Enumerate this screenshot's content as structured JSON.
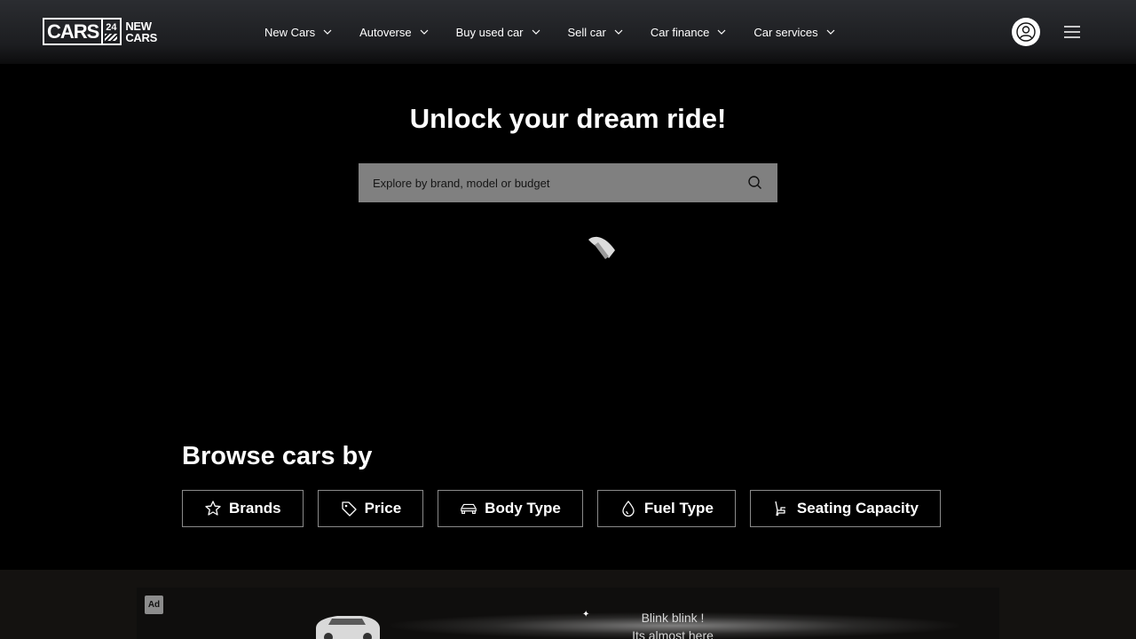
{
  "logo": {
    "primary": "CARS",
    "number": "24",
    "line1": "NEW",
    "line2": "CARS"
  },
  "nav": [
    {
      "label": "New Cars"
    },
    {
      "label": "Autoverse"
    },
    {
      "label": "Buy used car"
    },
    {
      "label": "Sell car"
    },
    {
      "label": "Car finance"
    },
    {
      "label": "Car services"
    }
  ],
  "hero": {
    "title": "Unlock your dream ride!",
    "search_placeholder": "Explore by brand, model or budget"
  },
  "browse": {
    "title": "Browse cars by",
    "filters": [
      {
        "label": "Brands",
        "icon": "star-icon"
      },
      {
        "label": "Price",
        "icon": "tag-icon"
      },
      {
        "label": "Body Type",
        "icon": "car-icon"
      },
      {
        "label": "Fuel Type",
        "icon": "drop-icon"
      },
      {
        "label": "Seating Capacity",
        "icon": "seat-icon"
      }
    ]
  },
  "ad": {
    "label": "Ad",
    "line1": "Blink blink !",
    "line2": "Its almost here"
  },
  "colors": {
    "background": "#000000",
    "search_bg": "#808080",
    "header_top": "#2b2d31"
  }
}
